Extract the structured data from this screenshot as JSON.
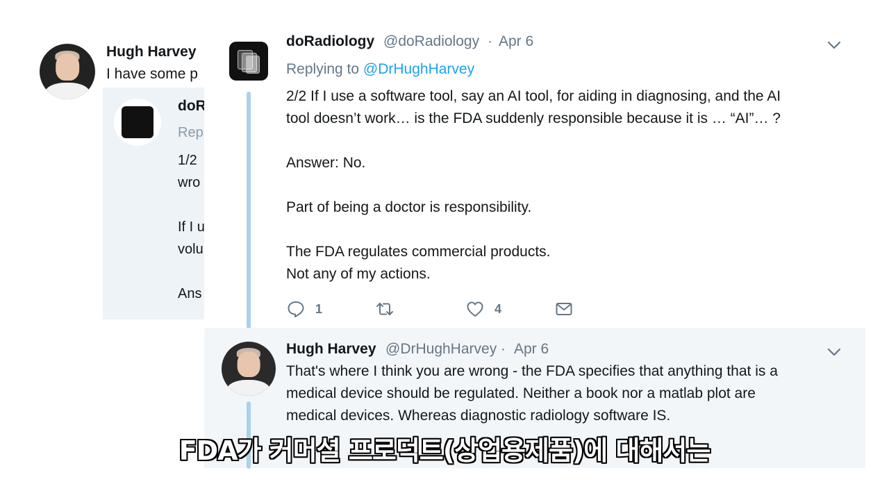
{
  "background_tweet": {
    "author_name": "Hugh Harvey",
    "text_fragment": "I have some p",
    "quote": {
      "author_fragment": "doR",
      "reply_fragment": "Rep",
      "lines": [
        "1/2",
        "wro",
        "",
        "If I u",
        "volu",
        "",
        "Ans"
      ]
    }
  },
  "main_tweet": {
    "author_name": "doRadiology",
    "handle": "@doRadiology",
    "separator": "·",
    "date": "Apr 6",
    "replying_label": "Replying to",
    "replying_handle": "@DrHughHarvey",
    "lines": [
      "2/2 If I use a software tool, say an AI tool, for aiding in diagnosing, and the AI",
      "tool doesn’t work… is the FDA suddenly responsible because it is … “AI”… ?",
      "Answer: No.",
      "Part of being a doctor is responsibility.",
      "The FDA regulates commercial products.",
      "Not any of my actions."
    ],
    "actions": {
      "reply_count": "1",
      "retweet_count": "",
      "like_count": "4"
    },
    "icons": [
      "reply-icon",
      "retweet-icon",
      "like-icon",
      "message-icon",
      "chevron-down-icon"
    ]
  },
  "reply_tweet": {
    "author_name": "Hugh Harvey",
    "handle": "@DrHughHarvey",
    "separator": "·",
    "date": "Apr 6",
    "lines": [
      "That's where I think you are wrong - the FDA specifies that anything that is a",
      "medical device should be regulated. Neither a book nor a matlab plot are",
      "medical devices. Whereas diagnostic radiology software IS."
    ]
  },
  "subtitle": "FDA가 커머셜 프로덕트(상업용제품)에 대해서는",
  "colors": {
    "link": "#1da1f2",
    "muted": "#657786",
    "thread_line": "#a8d3ea",
    "reply_bg": "#f3f6f9"
  }
}
